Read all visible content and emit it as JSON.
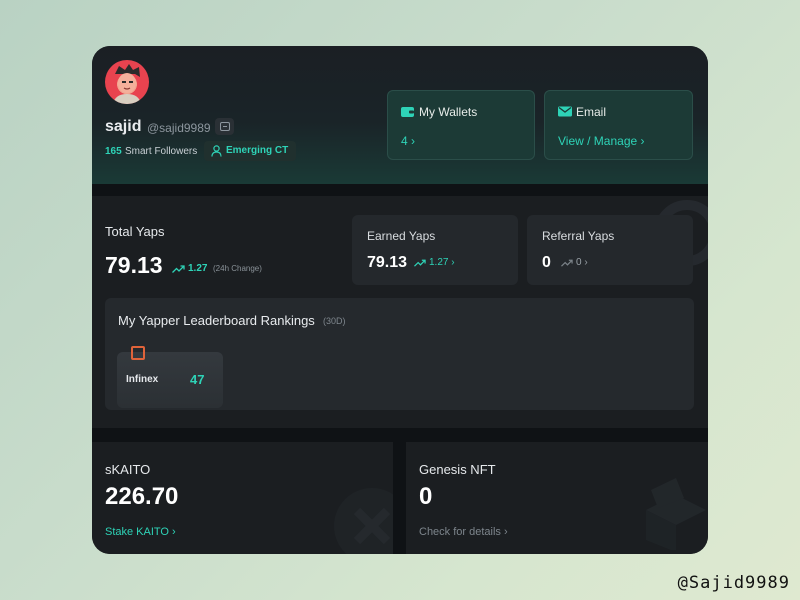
{
  "profile": {
    "name": "sajid",
    "handle": "@sajid9989",
    "followers_count": "165",
    "followers_label": "Smart Followers",
    "badge": "Emerging CT"
  },
  "wallets": {
    "title": "My Wallets",
    "value": "4 ›"
  },
  "email": {
    "title": "Email",
    "link": "View / Manage ›"
  },
  "total_yaps": {
    "label": "Total Yaps",
    "value": "79.13",
    "change": "1.27",
    "change_note": "(24h Change)"
  },
  "earned_yaps": {
    "label": "Earned Yaps",
    "value": "79.13",
    "change": "1.27 ›"
  },
  "referral_yaps": {
    "label": "Referral Yaps",
    "value": "0",
    "change": "0 ›"
  },
  "leaderboard": {
    "title": "My Yapper Leaderboard Rankings",
    "period": "(30D)",
    "entries": [
      {
        "project": "Infinex",
        "rank": "47"
      }
    ]
  },
  "skaito": {
    "label": "sKAITO",
    "value": "226.70",
    "link": "Stake KAITO ›"
  },
  "genesis_nft": {
    "label": "Genesis NFT",
    "value": "0",
    "link": "Check for details ›"
  },
  "watermark": "@Sajid9989",
  "colors": {
    "accent": "#2ed3b7",
    "background": "#0f1215",
    "panel": "#1b1e21",
    "tile": "#1c3a36"
  },
  "icons": [
    "wallet-icon",
    "mail-icon",
    "trend-up-icon",
    "person-icon",
    "copy-icon",
    "infinex-logo-icon"
  ]
}
